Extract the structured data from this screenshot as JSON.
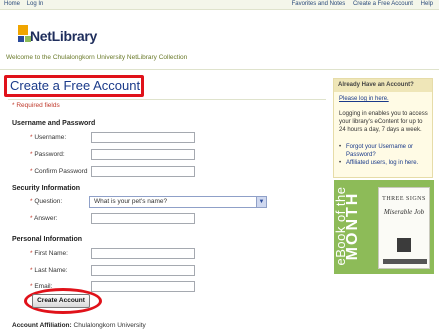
{
  "topbar": {
    "left_links": [
      "Home",
      "Log In"
    ],
    "right_links": [
      "Favorites and Notes",
      "Create a Free Account",
      "Help"
    ]
  },
  "header": {
    "brand": "NetLibrary",
    "brand_tm": "",
    "welcome": "Welcome to the Chulalongkorn University NetLibrary Collection",
    "logo_colors": [
      "#f0a500",
      "#2a4a9a",
      "#8dbb58"
    ]
  },
  "main": {
    "title": "Create a Free Account",
    "required_note": "* Required fields",
    "sections": {
      "username_password": "Username and Password",
      "security": "Security Information",
      "personal": "Personal Information"
    },
    "fields": {
      "username": "Username:",
      "password": "Password:",
      "confirm_password": "Confirm Password",
      "question": "Question:",
      "answer": "Answer:",
      "first_name": "First Name:",
      "last_name": "Last Name:",
      "email": "Email:"
    },
    "question_selected": "What is your pet's name?",
    "create_button": "Create Account",
    "affiliation_label": "Account Affiliation:",
    "affiliation_value": "Chulalongkorn University"
  },
  "sidebar": {
    "heading": "Already Have an Account?",
    "login_link": "Please log in here.",
    "description": "Logging in enables you to access your library's eContent for up to 24 hours a day, 7 days a week.",
    "links": [
      "Forgot your Username or Password?",
      "Affiliated users, log in here."
    ]
  },
  "ebook_promo": {
    "line1": "eBook of the",
    "line2": "MONTH",
    "cover_title_1": "THREE SIGNS",
    "cover_title_2": "Miserable Job",
    "colors": {
      "bg": "#8dbb58"
    }
  },
  "colors": {
    "accent": "#1a3a8a",
    "highlight": "#e0121a"
  }
}
